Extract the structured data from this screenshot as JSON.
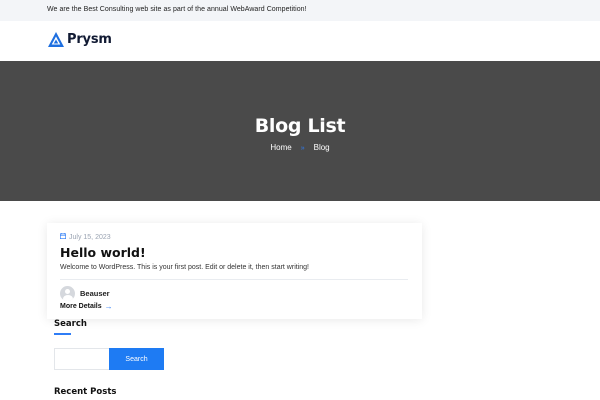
{
  "topbar": {
    "announcement": "We are the Best Consulting web site as part of the annual WebAward Competition!"
  },
  "header": {
    "logo_text": "Prysm",
    "logo_icon": "prysm-triangle-logo"
  },
  "hero": {
    "title": "Blog List",
    "breadcrumb": {
      "home": "Home",
      "separator": "»",
      "current": "Blog"
    }
  },
  "post": {
    "date": "July 15, 2023",
    "title": "Hello world!",
    "excerpt": "Welcome to WordPress. This is your first post. Edit or delete it, then start writing!",
    "author": "Beauser",
    "more_label": "More Details",
    "more_arrow": "→"
  },
  "sidebar": {
    "search_title": "Search",
    "search_placeholder": "",
    "search_button": "Search",
    "recent_title": "Recent Posts"
  },
  "colors": {
    "accent": "#1e7bf3",
    "hero_bg": "#4a4a4a",
    "topbar_bg": "#f3f5f8"
  }
}
